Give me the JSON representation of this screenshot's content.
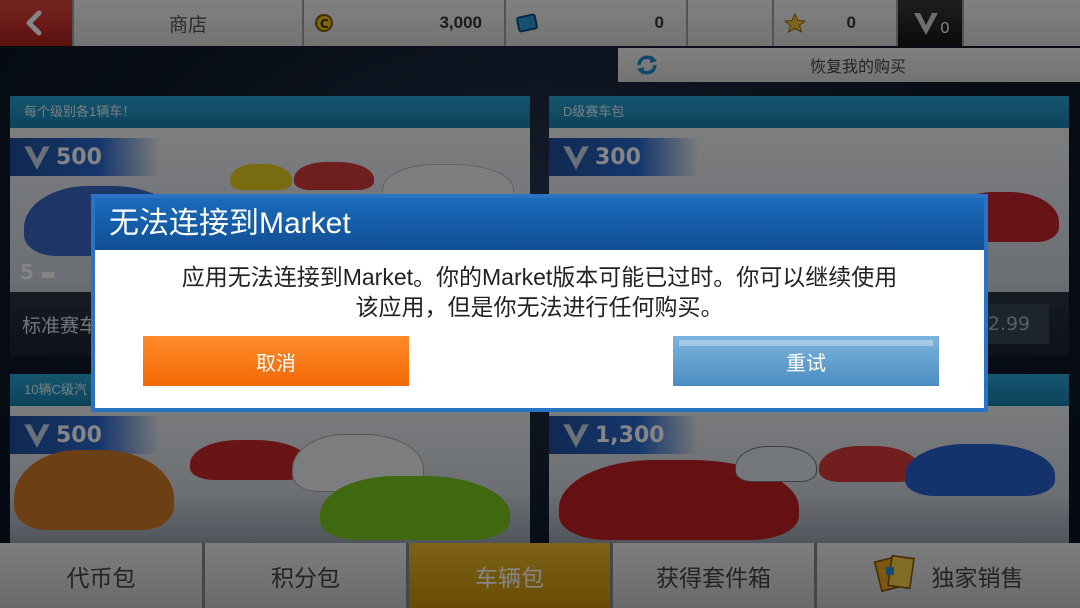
{
  "topbar": {
    "shop_label": "商店",
    "cash_value": "3,000",
    "tokens_value": "0",
    "stars_value": "0",
    "v_value": "0",
    "restore_label": "恢复我的购买"
  },
  "cards": [
    {
      "header": "每个级别各1辆车！",
      "price": "500",
      "count": "5",
      "title": "标准赛车",
      "price_box": ""
    },
    {
      "header": "D级赛车包",
      "price": "300",
      "count": "",
      "title": "",
      "price_box": "2.99"
    },
    {
      "header": "10辆C级汽",
      "price": "500",
      "count": "",
      "title": "",
      "price_box": ""
    },
    {
      "header": "",
      "price": "1,300",
      "count": "",
      "title": "",
      "price_box": ""
    }
  ],
  "tabs": [
    {
      "label": "代币包",
      "active": false
    },
    {
      "label": "积分包",
      "active": false
    },
    {
      "label": "车辆包",
      "active": true
    },
    {
      "label": "获得套件箱",
      "active": false
    },
    {
      "label": "独家销售",
      "active": false
    }
  ],
  "dialog": {
    "title": "无法连接到Market",
    "message_line1": "应用无法连接到Market。你的Market版本可能已过时。你可以继续使用",
    "message_line2": "该应用，但是你无法进行任何购买。",
    "cancel_label": "取消",
    "retry_label": "重试"
  },
  "colors": {
    "accent_blue": "#1c6bbb",
    "cancel_orange": "#f26a06",
    "retry_blue": "#4b8dc2",
    "tab_active": "#e2a91e",
    "back_red": "#c8302a"
  }
}
